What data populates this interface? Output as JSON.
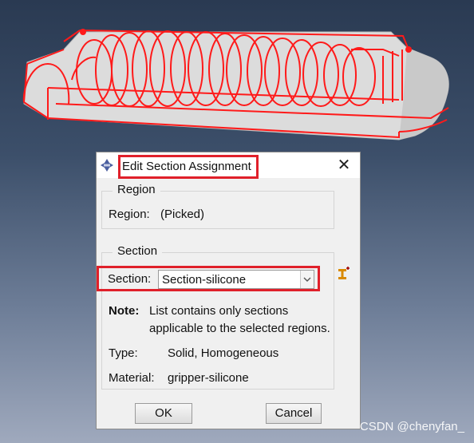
{
  "dialog": {
    "title": "Edit Section Assignment",
    "close_glyph": "✕",
    "region": {
      "heading": "Region",
      "label": "Region:",
      "value": "(Picked)"
    },
    "section": {
      "heading": "Section",
      "label": "Section:",
      "selected": "Section-silicone",
      "note_label": "Note:",
      "note_line1": "List contains only sections",
      "note_line2": "applicable to the selected regions.",
      "type_label": "Type:",
      "type_value": "Solid, Homogeneous",
      "material_label": "Material:",
      "material_value": "gripper-silicone"
    },
    "buttons": {
      "ok": "OK",
      "cancel": "Cancel"
    }
  },
  "watermark": "CSDN @chenyfan_",
  "colors": {
    "highlight": "#e0202a",
    "model_surface": "#d8d8d8",
    "background_top": "#2a3a52",
    "background_bottom": "#9fa9bd"
  },
  "icons": {
    "dialog_icon": "abaqus-dialog-icon",
    "create_section": "create-section-icon",
    "dropdown": "chevron-down-icon",
    "close": "close-icon"
  }
}
